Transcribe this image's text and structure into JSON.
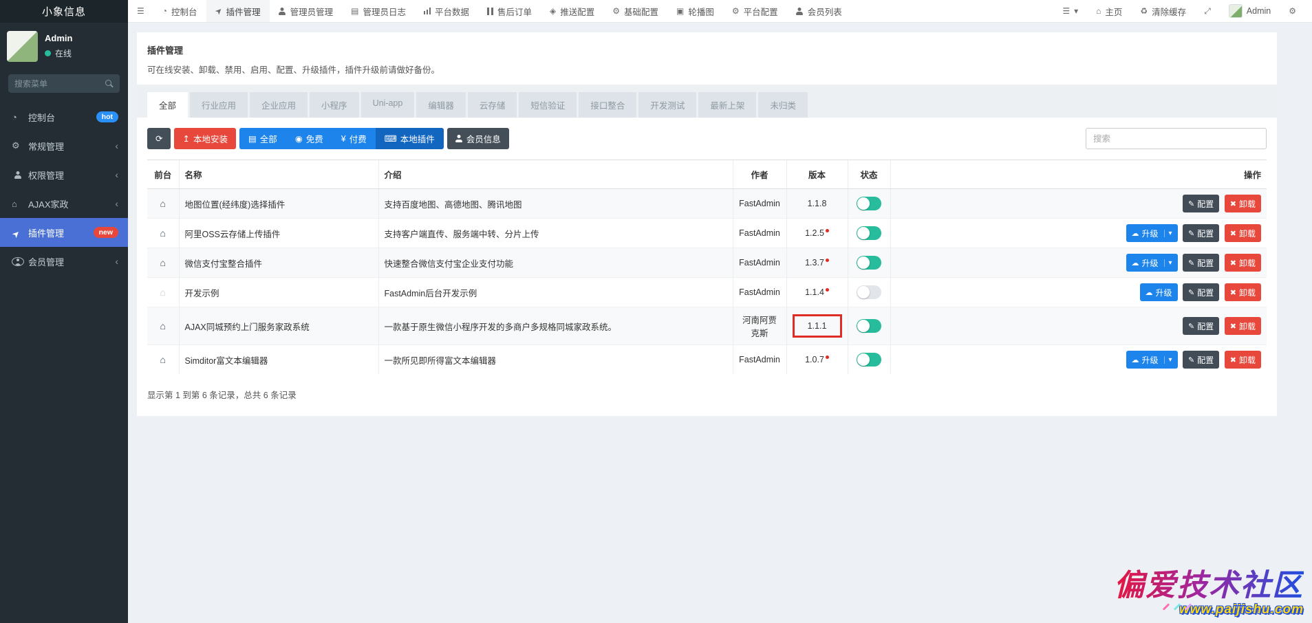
{
  "colors": {
    "sidebar_bg": "#232d33",
    "sidebar_active": "#4a70d6",
    "primary_blue": "#1d84ec",
    "primary_blue_active": "#1266bf",
    "danger_red": "#e8473b",
    "dark_button": "#434e58",
    "toggle_on": "#26bc9c",
    "hot_badge": "#2a8ff7",
    "new_badge": "#e8473b",
    "version_box_red": "#dd2b25"
  },
  "icons": {
    "hamburger": "☰",
    "dashboard": "◔",
    "send": "➤",
    "log": "▤",
    "code": "◈",
    "gear": "⚙",
    "gears": "⚙",
    "image": "▣",
    "home": "⌂",
    "trash": "♻",
    "fullscreen": "⤢",
    "menu": "☰",
    "caret": "▾",
    "refresh": "⟳",
    "upload": "↥",
    "list": "▤",
    "coin": "◉",
    "yen": "¥",
    "laptop": "⌨",
    "cloud": "☁",
    "pencil": "✎",
    "x": "✖",
    "chevron": "‹"
  },
  "navbar": {
    "brand": "小象信息",
    "items": [
      {
        "label": "控制台"
      },
      {
        "label": "插件管理"
      },
      {
        "label": "管理员管理"
      },
      {
        "label": "管理员日志"
      },
      {
        "label": "平台数据"
      },
      {
        "label": "售后订单"
      },
      {
        "label": "推送配置"
      },
      {
        "label": "基础配置"
      },
      {
        "label": "轮播图"
      },
      {
        "label": "平台配置"
      },
      {
        "label": "会员列表"
      }
    ],
    "right": {
      "home_label": "主页",
      "clear_cache_label": "清除缓存",
      "username": "Admin"
    }
  },
  "sidebar": {
    "user": {
      "name": "Admin",
      "status": "在线"
    },
    "search_placeholder": "搜索菜单",
    "items": [
      {
        "label": "控制台",
        "badge": "hot"
      },
      {
        "label": "常规管理"
      },
      {
        "label": "权限管理"
      },
      {
        "label": "AJAX家政"
      },
      {
        "label": "插件管理",
        "badge": "new"
      },
      {
        "label": "会员管理"
      }
    ]
  },
  "page": {
    "title": "插件管理",
    "subtitle": "可在线安装、卸载、禁用、启用、配置、升级插件，插件升级前请做好备份。",
    "tabs": [
      "全部",
      "行业应用",
      "企业应用",
      "小程序",
      "Uni-app",
      "编辑器",
      "云存储",
      "短信验证",
      "接口整合",
      "开发测试",
      "最新上架",
      "未归类"
    ],
    "active_tab": "全部",
    "toolbar": {
      "install_label": "本地安装",
      "filters": [
        "全部",
        "免费",
        "付费",
        "本地插件"
      ],
      "active_filter": "本地插件",
      "member_label": "会员信息",
      "search_placeholder": "搜索"
    },
    "table": {
      "columns": [
        "前台",
        "名称",
        "介绍",
        "作者",
        "版本",
        "状态",
        "操作"
      ],
      "action_labels": {
        "upgrade": "升级",
        "config": "配置",
        "uninstall": "卸载"
      },
      "rows": [
        {
          "name": "地图位置(经纬度)选择插件",
          "intro": "支持百度地图、高德地图、腾讯地图",
          "author": "FastAdmin",
          "version": "1.1.8",
          "has_update": false,
          "enabled": true,
          "front": true
        },
        {
          "name": "阿里OSS云存储上传插件",
          "intro": "支持客户端直传、服务端中转、分片上传",
          "author": "FastAdmin",
          "version": "1.2.5",
          "has_update": true,
          "enabled": true,
          "front": true
        },
        {
          "name": "微信支付宝整合插件",
          "intro": "快速整合微信支付宝企业支付功能",
          "author": "FastAdmin",
          "version": "1.3.7",
          "has_update": true,
          "enabled": true,
          "front": true
        },
        {
          "name": "开发示例",
          "intro": "FastAdmin后台开发示例",
          "author": "FastAdmin",
          "version": "1.1.4",
          "has_update": true,
          "enabled": false,
          "front": false
        },
        {
          "name": "AJAX同城预约上门服务家政系统",
          "intro": "一款基于原生微信小程序开发的多商户多规格同城家政系统。",
          "author": "河南阿贾克斯",
          "version": "1.1.1",
          "has_update": false,
          "enabled": true,
          "front": true,
          "version_highlighted": true
        },
        {
          "name": "Simditor富文本编辑器",
          "intro": "一款所见即所得富文本编辑器",
          "author": "FastAdmin",
          "version": "1.0.7",
          "has_update": true,
          "enabled": true,
          "front": true
        }
      ]
    },
    "footer": "显示第 1 到第 6 条记录，总共 6 条记录"
  },
  "watermark": {
    "title": "偏爱技术社区",
    "url": "www.paijishu.com"
  }
}
